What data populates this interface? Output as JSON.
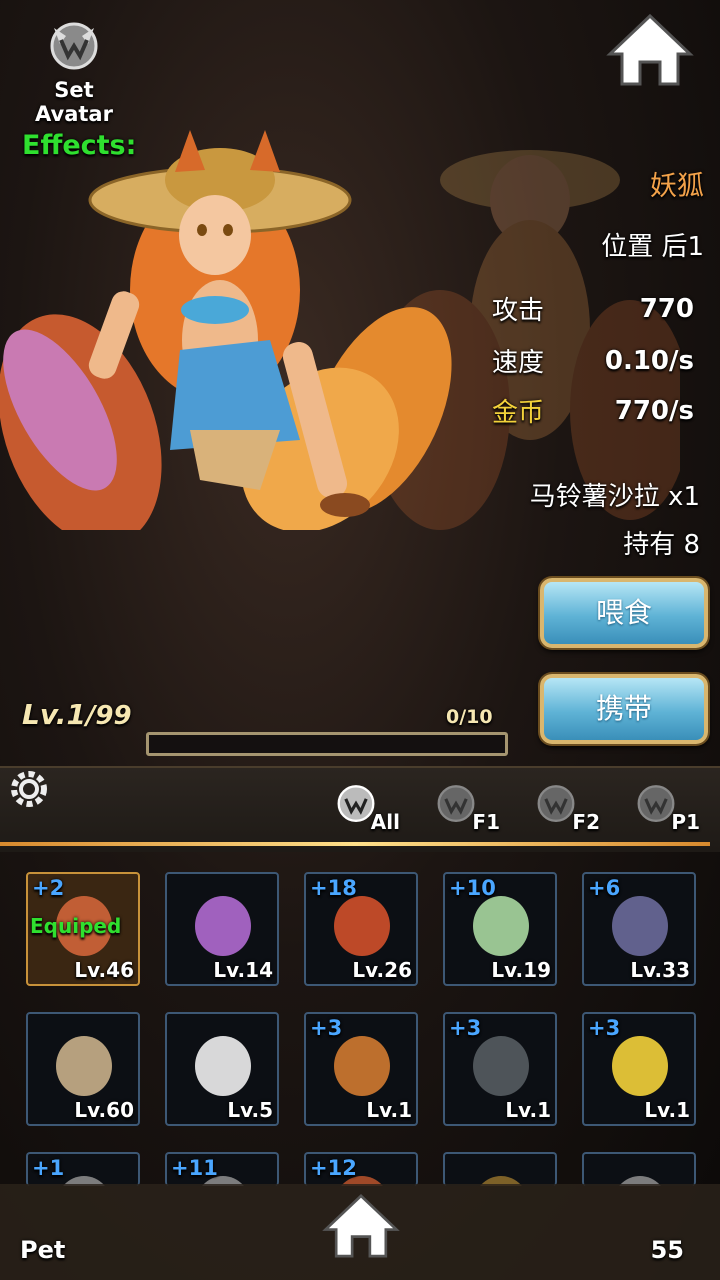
{
  "header": {
    "set_avatar_label": "Set Avatar",
    "effects_label": "Effects:"
  },
  "pet": {
    "name": "妖狐",
    "position": "位置 后1",
    "stats": [
      {
        "label": "攻击",
        "value": "770",
        "color": "#ffffff"
      },
      {
        "label": "速度",
        "value": "0.10/s",
        "color": "#ffffff"
      },
      {
        "label": "金币",
        "value": "770/s",
        "color": "#f3d23a"
      }
    ],
    "food": "马铃薯沙拉 x1",
    "owned": "持有 8",
    "feed_label": "喂食",
    "carry_label": "携带",
    "level": "Lv.1",
    "level_max": "/99",
    "exp_text": "0/10",
    "exp_progress": 0.0
  },
  "tabs": [
    {
      "label": "All"
    },
    {
      "label": "F1"
    },
    {
      "label": "F2"
    },
    {
      "label": "P1"
    }
  ],
  "pets_grid": [
    {
      "plus": "+2",
      "level": "Lv.46",
      "equipped": "Equiped",
      "icon": "fox-pet-icon"
    },
    {
      "plus": "",
      "level": "Lv.14",
      "icon": "mushroom-pet-icon"
    },
    {
      "plus": "+18",
      "level": "Lv.26",
      "icon": "mushroom-cap-pet-icon"
    },
    {
      "plus": "+10",
      "level": "Lv.19",
      "icon": "rabbit-pet-icon"
    },
    {
      "plus": "+6",
      "level": "Lv.33",
      "icon": "fly-pet-icon"
    },
    {
      "plus": "",
      "level": "Lv.60",
      "icon": "mummy-pet-icon"
    },
    {
      "plus": "",
      "level": "Lv.5",
      "icon": "ghost-pet-icon"
    },
    {
      "plus": "+3",
      "level": "Lv.1",
      "icon": "leaf-mushroom-pet-icon"
    },
    {
      "plus": "+3",
      "level": "Lv.1",
      "icon": "robot-egg-pet-icon"
    },
    {
      "plus": "+3",
      "level": "Lv.1",
      "icon": "chick-pet-icon"
    },
    {
      "plus": "+1",
      "level": "",
      "icon": "pet-icon"
    },
    {
      "plus": "+11",
      "level": "",
      "icon": "pet-icon"
    },
    {
      "plus": "+12",
      "level": "",
      "icon": "pet-icon"
    },
    {
      "plus": "",
      "level": "",
      "icon": "gear-pet-icon"
    },
    {
      "plus": "",
      "level": "",
      "icon": "pet-icon"
    }
  ],
  "footer": {
    "pet_label": "Pet",
    "count": "55"
  }
}
